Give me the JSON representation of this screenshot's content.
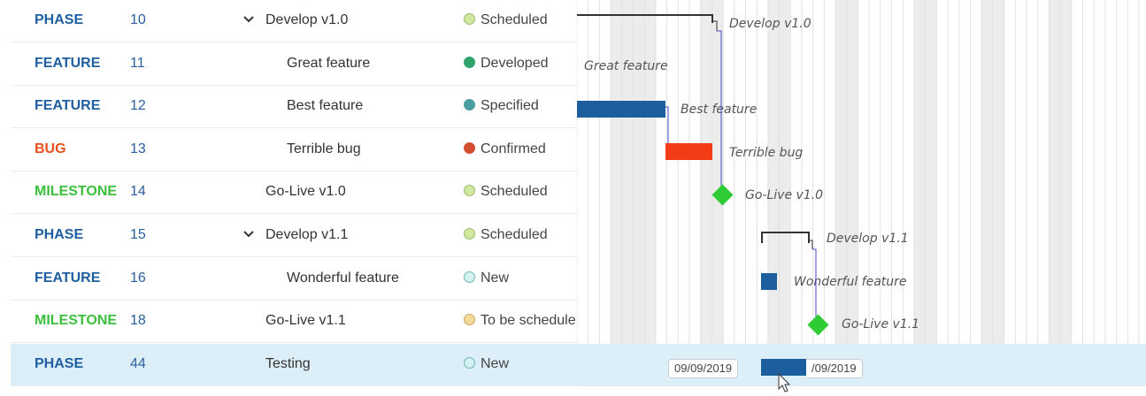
{
  "colors": {
    "phase": "#1f5ea0",
    "feature": "#1f5ea0",
    "bug": "#e8501b",
    "milestone": "#3cbf3c",
    "selected_row": "#dceef8",
    "bar_blue": "#1c5e9e",
    "bar_red": "#f23c16",
    "milestone_green": "#2fcb35"
  },
  "rows": [
    {
      "type": "PHASE",
      "type_color": "#1f5ea0",
      "id": "10",
      "subject": "Develop v1.0",
      "indent": 1,
      "collapsible": true,
      "status": "Scheduled",
      "status_color": "#cfe8a0",
      "status_border": "#9cba6b"
    },
    {
      "type": "FEATURE",
      "type_color": "#1f5ea0",
      "id": "11",
      "subject": "Great feature",
      "indent": 2,
      "collapsible": false,
      "status": "Developed",
      "status_color": "#2ea36a",
      "status_border": "#2ea36a"
    },
    {
      "type": "FEATURE",
      "type_color": "#1f5ea0",
      "id": "12",
      "subject": "Best feature",
      "indent": 2,
      "collapsible": false,
      "status": "Specified",
      "status_color": "#4a9ea0",
      "status_border": "#4a9ea0"
    },
    {
      "type": "BUG",
      "type_color": "#e8501b",
      "id": "13",
      "subject": "Terrible bug",
      "indent": 2,
      "collapsible": false,
      "status": "Confirmed",
      "status_color": "#d14e32",
      "status_border": "#d14e32"
    },
    {
      "type": "MILESTONE",
      "type_color": "#3cbf3c",
      "id": "14",
      "subject": "Go-Live v1.0",
      "indent": 1,
      "collapsible": false,
      "status": "Scheduled",
      "status_color": "#cfe8a0",
      "status_border": "#9cba6b"
    },
    {
      "type": "PHASE",
      "type_color": "#1f5ea0",
      "id": "15",
      "subject": "Develop v1.1",
      "indent": 1,
      "collapsible": true,
      "status": "Scheduled",
      "status_color": "#cfe8a0",
      "status_border": "#9cba6b"
    },
    {
      "type": "FEATURE",
      "type_color": "#1f5ea0",
      "id": "16",
      "subject": "Wonderful feature",
      "indent": 2,
      "collapsible": false,
      "status": "New",
      "status_color": "#d4f1f1",
      "status_border": "#6bb6b6"
    },
    {
      "type": "MILESTONE",
      "type_color": "#3cbf3c",
      "id": "18",
      "subject": "Go-Live v1.1",
      "indent": 1,
      "collapsible": false,
      "status": "To be schedule",
      "status_color": "#f5d99a",
      "status_border": "#c9a55a"
    },
    {
      "type": "PHASE",
      "type_color": "#1f5ea0",
      "id": "44",
      "subject": "Testing",
      "indent": 1,
      "collapsible": false,
      "status": "New",
      "status_color": "#d4f1f1",
      "status_border": "#6bb6b6",
      "selected": true
    }
  ],
  "gantt": {
    "labels": {
      "develop_v10": "Develop v1.0",
      "great_feature": "Great feature",
      "best_feature": "Best feature",
      "terrible_bug": "Terrible bug",
      "golive_v10": "Go-Live v1.0",
      "develop_v11": "Develop v1.1",
      "wonderful_feature": "Wonderful feature",
      "golive_v11": "Go-Live v1.1"
    },
    "date_start": "09/09/2019",
    "date_end": "/09/2019"
  }
}
